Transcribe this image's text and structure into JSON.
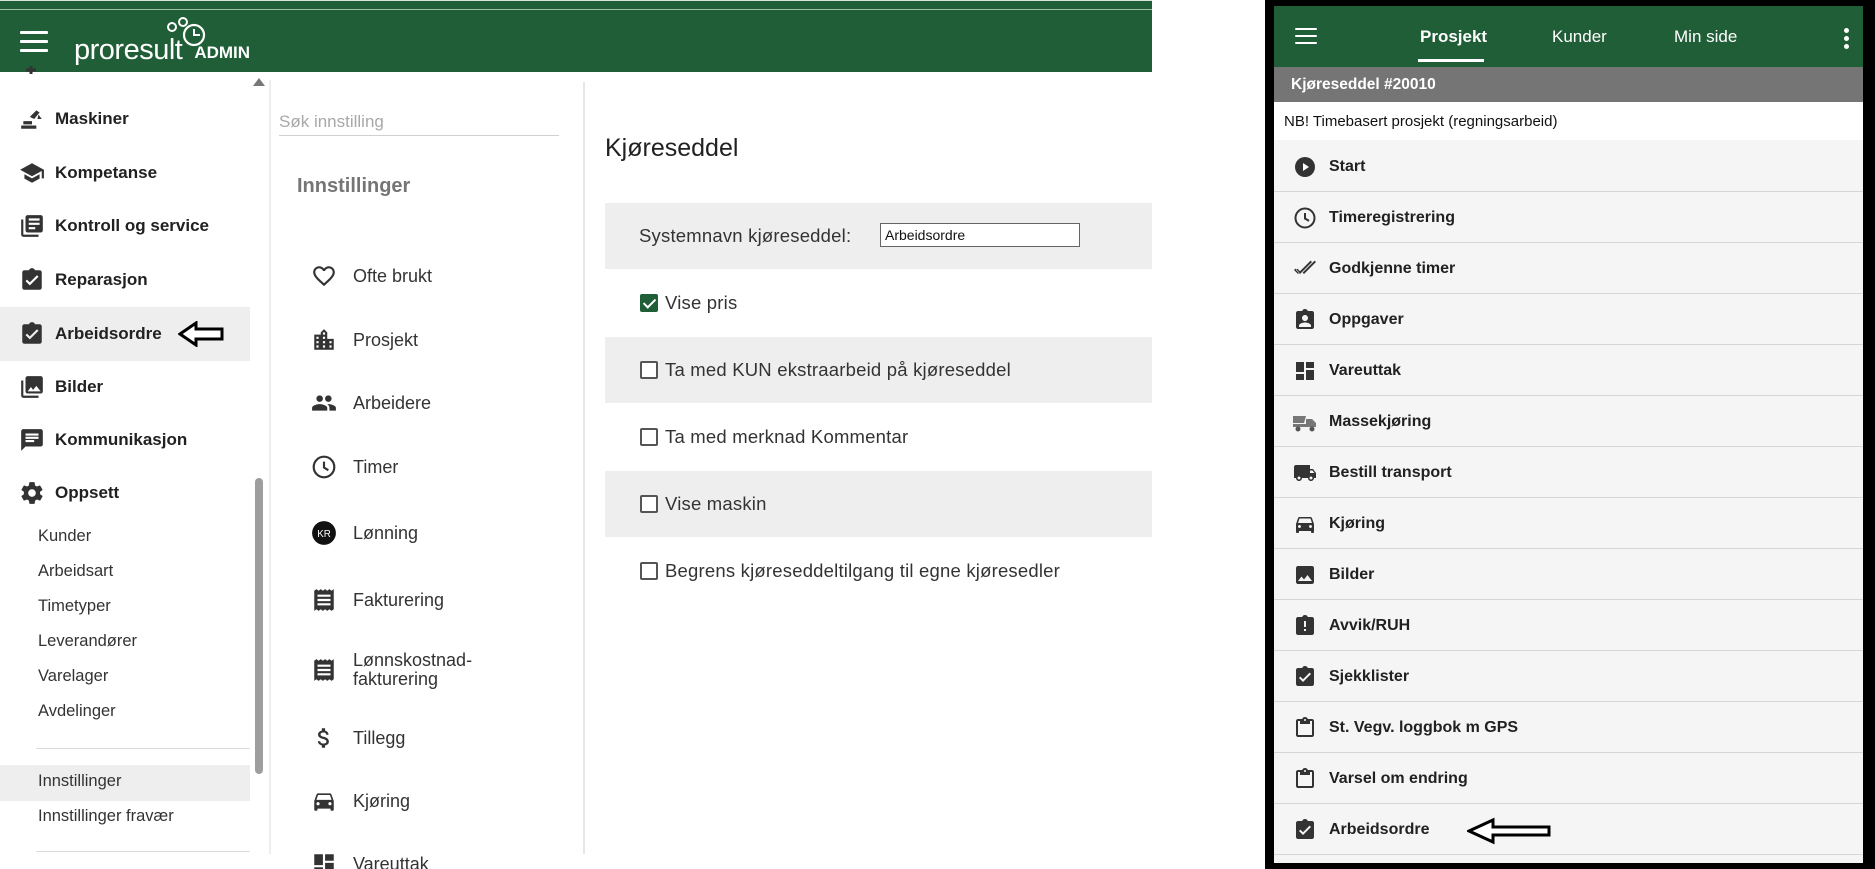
{
  "admin": {
    "logo_word": "proresult",
    "logo_badge": "ADMIN",
    "sidebar": {
      "items": [
        {
          "label": "Maskiner",
          "icon": "excavator-icon"
        },
        {
          "label": "Kompetanse",
          "icon": "school-cap-icon"
        },
        {
          "label": "Kontroll og service",
          "icon": "library-books-icon"
        },
        {
          "label": "Reparasjon",
          "icon": "assignment-check-icon"
        },
        {
          "label": "Arbeidsordre",
          "icon": "assignment-check-icon"
        },
        {
          "label": "Bilder",
          "icon": "photo-library-icon"
        },
        {
          "label": "Kommunikasjon",
          "icon": "chat-icon"
        },
        {
          "label": "Oppsett",
          "icon": "gear-icon"
        }
      ],
      "sub_items": [
        "Kunder",
        "Arbeidsart",
        "Timetyper",
        "Leverandører",
        "Varelager",
        "Avdelinger"
      ],
      "settings_items": [
        "Innstillinger",
        "Innstillinger fravær"
      ]
    },
    "settings_menu": {
      "search_placeholder": "Søk innstilling",
      "title": "Innstillinger",
      "items": [
        {
          "label": "Ofte brukt",
          "icon": "heart-outline-icon"
        },
        {
          "label": "Prosjekt",
          "icon": "city-icon"
        },
        {
          "label": "Arbeidere",
          "icon": "people-icon"
        },
        {
          "label": "Timer",
          "icon": "clock-icon"
        },
        {
          "label": "Lønning",
          "icon": "kr-badge-icon"
        },
        {
          "label": "Fakturering",
          "icon": "receipt-icon"
        },
        {
          "label": "Lønnskostnad-",
          "label2": "fakturering",
          "icon": "receipt-icon"
        },
        {
          "label": "Tillegg",
          "icon": "dollar-icon"
        },
        {
          "label": "Kjøring",
          "icon": "car-icon"
        },
        {
          "label": "Vareuttak",
          "icon": "dashboard-icon"
        }
      ],
      "kr_text": "KR"
    },
    "content": {
      "title": "Kjøreseddel",
      "systemname_label": "Systemnavn kjøreseddel:",
      "systemname_value": "Arbeidsordre",
      "options": [
        {
          "label": "Vise pris",
          "checked": true
        },
        {
          "label": "Ta med KUN ekstraarbeid på kjøreseddel",
          "checked": false
        },
        {
          "label": "Ta med merknad Kommentar",
          "checked": false
        },
        {
          "label": "Vise maskin",
          "checked": false
        },
        {
          "label": "Begrens kjøreseddeltilgang til egne kjøresedler",
          "checked": false
        }
      ]
    }
  },
  "mobile": {
    "tabs": [
      "Prosjekt",
      "Kunder",
      "Min side"
    ],
    "active_tab": "Prosjekt",
    "subheader": "Kjøreseddel #20010",
    "note": "NB! Timebasert prosjekt (regningsarbeid)",
    "menu": [
      {
        "label": "Start",
        "icon": "play-circle-icon"
      },
      {
        "label": "Timeregistrering",
        "icon": "clock-icon"
      },
      {
        "label": "Godkjenne timer",
        "icon": "double-check-icon"
      },
      {
        "label": "Oppgaver",
        "icon": "assignment-person-icon"
      },
      {
        "label": "Vareuttak",
        "icon": "dashboard-icon"
      },
      {
        "label": "Massekjøring",
        "icon": "dump-truck-icon"
      },
      {
        "label": "Bestill transport",
        "icon": "truck-icon"
      },
      {
        "label": "Kjøring",
        "icon": "car-icon"
      },
      {
        "label": "Bilder",
        "icon": "image-icon"
      },
      {
        "label": "Avvik/RUH",
        "icon": "alert-clipboard-icon"
      },
      {
        "label": "Sjekklister",
        "icon": "assignment-check-icon"
      },
      {
        "label": "St. Vegv. loggbok m GPS",
        "icon": "clipboard-icon"
      },
      {
        "label": "Varsel om endring",
        "icon": "clipboard-icon"
      },
      {
        "label": "Arbeidsordre",
        "icon": "assignment-check-icon"
      }
    ]
  },
  "colors": {
    "brand_green": "#1f5e36",
    "subheader_gray": "#757575"
  }
}
